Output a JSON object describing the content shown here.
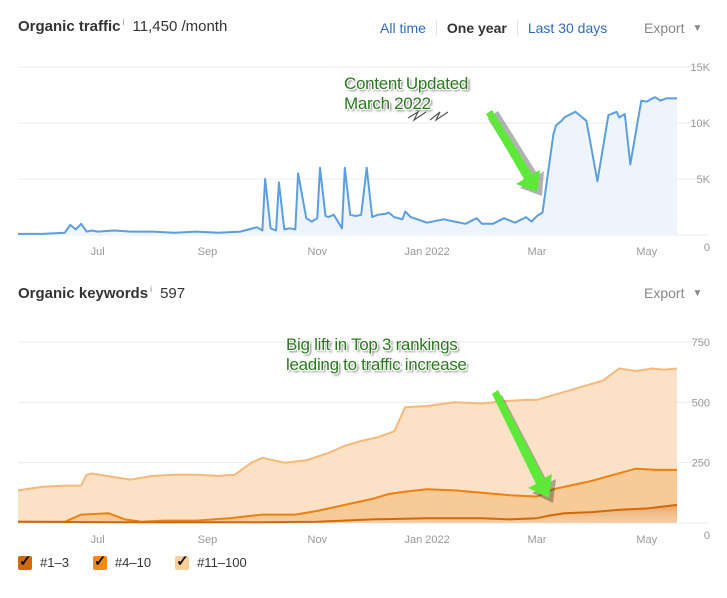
{
  "traffic": {
    "title": "Organic traffic",
    "info_icon": "i",
    "value": "11,450 /month",
    "ranges": [
      {
        "label": "All time",
        "active": false
      },
      {
        "label": "One year",
        "active": true
      },
      {
        "label": "Last 30 days",
        "active": false
      }
    ],
    "export_label": "Export",
    "annotation": [
      "Content Updated",
      "March 2022"
    ]
  },
  "keywords": {
    "title": "Organic keywords",
    "info_icon": "i",
    "value": "597",
    "export_label": "Export",
    "annotation": [
      "Big lift in Top 3 rankings",
      "leading to traffic increase"
    ],
    "legend": [
      {
        "label": "#1–3",
        "color": "#d06a0a",
        "checked": true
      },
      {
        "label": "#4–10",
        "color": "#f28a1a",
        "checked": true
      },
      {
        "label": "#11–100",
        "color": "#f9cf9c",
        "checked": true
      }
    ]
  },
  "colors": {
    "traffic_line": "#5b9fe0",
    "traffic_fill": "#eef4fc",
    "annotation_arrow": "#5ee83a",
    "annotation_text": "#2a7a1e",
    "kw_top3": "#d06a0a",
    "kw_4_10": "#f28a1a",
    "kw_11_100": "#f9c48a"
  },
  "chart_data": [
    {
      "type": "area",
      "title": "Organic traffic",
      "xlabel": "",
      "ylabel": "",
      "x_ticks": [
        "Jul",
        "Sep",
        "Nov",
        "Jan 2022",
        "Mar",
        "May"
      ],
      "y_ticks": [
        "0",
        "5K",
        "10K",
        "15K"
      ],
      "ylim": [
        0,
        15000
      ],
      "x_range_months": [
        -1.45,
        10.55
      ],
      "x_tick_months": [
        0,
        2,
        4,
        6,
        8,
        10
      ],
      "grid": true,
      "series": [
        {
          "name": "Organic traffic",
          "x_months": [
            -1.45,
            -1.0,
            -0.6,
            -0.5,
            -0.4,
            -0.3,
            -0.2,
            -0.1,
            0.0,
            0.3,
            0.6,
            1.0,
            1.4,
            1.8,
            2.2,
            2.6,
            2.9,
            3.0,
            3.05,
            3.15,
            3.25,
            3.3,
            3.4,
            3.5,
            3.6,
            3.65,
            3.8,
            3.9,
            4.0,
            4.05,
            4.15,
            4.2,
            4.3,
            4.45,
            4.5,
            4.6,
            4.7,
            4.8,
            4.9,
            5.0,
            5.1,
            5.25,
            5.3,
            5.4,
            5.55,
            5.6,
            5.7,
            6.0,
            6.3,
            6.5,
            6.7,
            6.9,
            7.0,
            7.2,
            7.4,
            7.6,
            7.8,
            7.9,
            8.0,
            8.1,
            8.3,
            8.35,
            8.45,
            8.5,
            8.7,
            8.9,
            9.1,
            9.3,
            9.45,
            9.5,
            9.6,
            9.7,
            9.9,
            10.0,
            10.1,
            10.15,
            10.25,
            10.35,
            10.55
          ],
          "values": [
            100,
            100,
            200,
            900,
            500,
            1000,
            300,
            400,
            300,
            400,
            300,
            300,
            200,
            300,
            200,
            300,
            700,
            400,
            5000,
            600,
            400,
            4700,
            500,
            600,
            500,
            5500,
            1500,
            1200,
            1500,
            6000,
            1700,
            1600,
            1800,
            600,
            6000,
            1800,
            1700,
            1800,
            6000,
            1600,
            1800,
            1900,
            2000,
            1600,
            1400,
            2100,
            1600,
            1100,
            1400,
            1200,
            1000,
            1500,
            1000,
            1000,
            1500,
            1100,
            1600,
            1200,
            1700,
            2000,
            9000,
            9800,
            10200,
            10500,
            11000,
            10200,
            4800,
            10700,
            11000,
            10500,
            10800,
            6300,
            12000,
            11900,
            12200,
            12300,
            12000,
            12200,
            12200
          ]
        }
      ]
    },
    {
      "type": "area",
      "title": "Organic keywords",
      "xlabel": "",
      "ylabel": "",
      "x_ticks": [
        "Jul",
        "Sep",
        "Nov",
        "Jan 2022",
        "Mar",
        "May"
      ],
      "y_ticks": [
        "0",
        "250",
        "500",
        "750"
      ],
      "ylim": [
        0,
        750
      ],
      "x_range_months": [
        -1.45,
        10.55
      ],
      "x_tick_months": [
        0,
        2,
        4,
        6,
        8,
        10
      ],
      "grid": true,
      "stacked": false,
      "series": [
        {
          "name": "#11–100",
          "x_months": [
            -1.45,
            -1.0,
            -0.6,
            -0.3,
            -0.2,
            -0.1,
            0.3,
            0.6,
            1.0,
            1.4,
            1.8,
            2.2,
            2.5,
            2.8,
            3.0,
            3.4,
            3.8,
            4.2,
            4.5,
            4.8,
            5.1,
            5.4,
            5.6,
            6.0,
            6.5,
            7.0,
            7.4,
            7.8,
            8.0,
            8.3,
            8.6,
            8.9,
            9.2,
            9.5,
            9.8,
            10.1,
            10.3,
            10.55
          ],
          "values": [
            135,
            150,
            155,
            155,
            200,
            205,
            190,
            180,
            195,
            200,
            200,
            195,
            200,
            250,
            270,
            250,
            260,
            290,
            320,
            340,
            355,
            380,
            480,
            485,
            500,
            495,
            505,
            510,
            510,
            530,
            550,
            570,
            590,
            640,
            630,
            640,
            635,
            640
          ]
        },
        {
          "name": "#4–10",
          "x_months": [
            -1.45,
            -0.6,
            -0.45,
            -0.3,
            0.2,
            0.5,
            0.8,
            1.2,
            1.8,
            2.4,
            3.0,
            3.6,
            4.0,
            4.5,
            5.0,
            5.3,
            5.6,
            6.0,
            6.5,
            7.0,
            7.5,
            8.0,
            8.3,
            8.6,
            9.0,
            9.4,
            9.8,
            10.2,
            10.55
          ],
          "values": [
            5,
            5,
            20,
            35,
            40,
            15,
            5,
            10,
            10,
            20,
            35,
            35,
            50,
            75,
            100,
            120,
            130,
            140,
            135,
            125,
            115,
            110,
            140,
            155,
            175,
            200,
            225,
            220,
            220
          ]
        },
        {
          "name": "#1–3",
          "x_months": [
            -1.45,
            1.0,
            3.0,
            4.0,
            5.0,
            6.0,
            7.0,
            7.5,
            8.0,
            8.2,
            8.5,
            9.0,
            9.5,
            10.0,
            10.55
          ],
          "values": [
            5,
            3,
            3,
            5,
            15,
            20,
            20,
            15,
            20,
            30,
            40,
            45,
            55,
            60,
            75
          ]
        }
      ]
    }
  ]
}
